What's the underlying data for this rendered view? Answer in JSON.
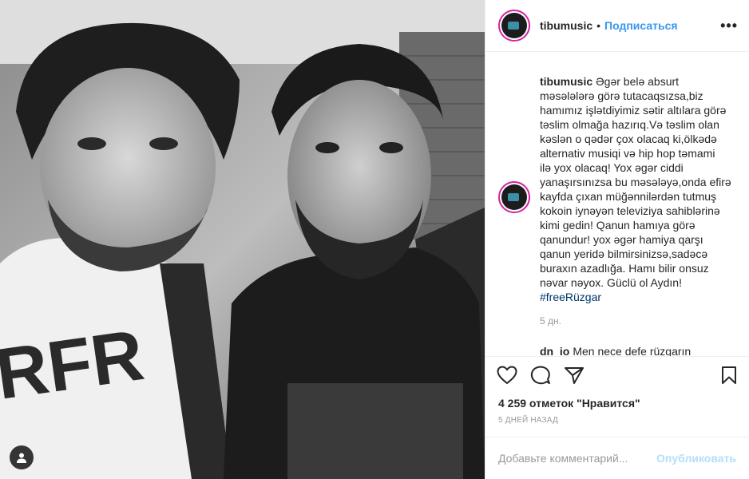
{
  "post": {
    "username": "tibumusic",
    "separator": "•",
    "follow_label": "Подписаться",
    "more_label": "•••",
    "caption_username": "tibumusic",
    "caption_lines": [
      "Əgər belə absurt",
      "məsələlərə görə tutacaqsızsa,biz",
      "hamımız işlətdiyimiz sətir altılara görə",
      "təslim olmağa hazırıq.Və təslim olan",
      "kəslən o qədər çox olacaq ki,ölkədə",
      "alternativ musiqi və hip hop təmami",
      "ilə yox olacaq! Yox əgər ciddi",
      "yanaşırsınızsa bu məsələyə,onda efirə",
      "kayfda çıxan müğənnilərdən tutmuş",
      "kokoin iynəyən televiziya sahiblərinə",
      "kimi gedin! Qanun hamıya görə",
      "qanundur! yox əgər hamiya qarşı",
      "qanun yeridə bilmirsinizsə,sadəcə",
      "buraxın azadlığa. Hamı bilir onsuz",
      "nəvar nəyox. Güclü ol Aydın!"
    ],
    "hashtag": "#freeRüzgar",
    "caption_time": "5 дн.",
    "comment2_user": "dn_io",
    "comment2_text": "Men nece defe rüzgarın",
    "likes_text": "4 259 отметок \"Нравится\"",
    "posted_ago": "5 ДНЕЙ НАЗАД",
    "comment_placeholder": "Добавьте комментарий...",
    "publish_label": "Опубликовать"
  },
  "icons": {
    "like": "heart-icon",
    "comment": "comment-icon",
    "share": "share-icon",
    "save": "bookmark-icon",
    "tag": "user-tag-icon"
  },
  "colors": {
    "link": "#3897f0",
    "hashtag": "#003569",
    "muted": "#999999",
    "publish_disabled": "#b2dffc",
    "avatar_ring": "#d6249f"
  }
}
